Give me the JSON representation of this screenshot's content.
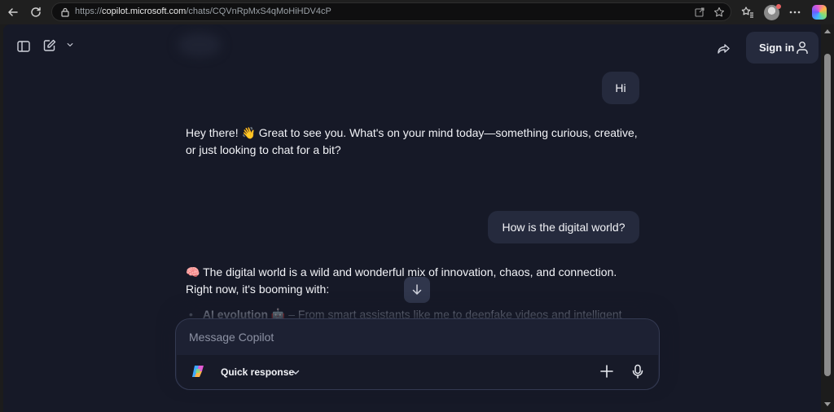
{
  "browser": {
    "url_prefix": "https://",
    "url_host": "copilot.microsoft.com",
    "url_path": "/chats/CQVnRpMxS4qMoHiHDV4cP"
  },
  "header": {
    "sign_in_label": "Sign in"
  },
  "conversation": {
    "user_message_1": "Hi",
    "assistant_message_1": "Hey there! 👋 Great to see you. What's on your mind today—something curious, creative, or just looking to chat for a bit?",
    "user_message_2": "How is the digital world?",
    "assistant_message_2": "🧠 The digital world is a wild and wonderful mix of innovation, chaos, and connection. Right now, it's booming with:",
    "bullet_1_title": "AI evolution",
    "bullet_1_emoji": "🤖",
    "bullet_1_text": " – From smart assistants like me to deepfake videos and intelligent"
  },
  "composer": {
    "placeholder": "Message Copilot",
    "mode_label": "Quick response"
  },
  "colors": {
    "page_bg": "#161927",
    "bubble_bg": "#252a3d",
    "composer_bg": "#1d2133"
  },
  "icons": [
    "back-icon",
    "refresh-icon",
    "lock-icon",
    "open-app-icon",
    "star-icon",
    "favorites-icon",
    "profile-avatar",
    "more-icon",
    "copilot-icon",
    "sidebar-icon",
    "new-chat-icon",
    "chevron-down-icon",
    "share-icon",
    "user-icon",
    "arrow-down-icon",
    "plus-icon",
    "microphone-icon"
  ]
}
